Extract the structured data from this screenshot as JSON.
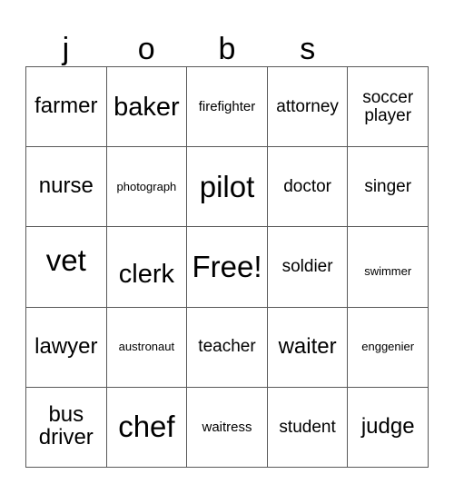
{
  "card": {
    "title_letters": [
      "j",
      "o",
      "b",
      "s",
      ""
    ],
    "grid": {
      "rows": 5,
      "columns": 5,
      "border_color": "#595959",
      "background_color": "#ffffff",
      "text_color": "#000000"
    },
    "cells": [
      [
        {
          "label": "farmer",
          "size": "l"
        },
        {
          "label": "baker",
          "size": "xl"
        },
        {
          "label": "firefighter",
          "size": "s"
        },
        {
          "label": "attorney",
          "size": "m"
        },
        {
          "label": "soccer\nplayer",
          "size": "m"
        }
      ],
      [
        {
          "label": "nurse",
          "size": "l",
          "valign": "center"
        },
        {
          "label": "photograph",
          "size": "xs"
        },
        {
          "label": "pilot",
          "size": "xxl"
        },
        {
          "label": "doctor",
          "size": "m"
        },
        {
          "label": "singer",
          "size": "m"
        }
      ],
      [
        {
          "label": "vet",
          "size": "xxl",
          "valign": "up"
        },
        {
          "label": "clerk",
          "size": "xl",
          "valign": "down"
        },
        {
          "label": "Free!",
          "size": "xxl"
        },
        {
          "label": "soldier",
          "size": "m"
        },
        {
          "label": "swimmer",
          "size": "xs",
          "valign": "down2"
        }
      ],
      [
        {
          "label": "lawyer",
          "size": "l"
        },
        {
          "label": "austronaut",
          "size": "xs"
        },
        {
          "label": "teacher",
          "size": "m"
        },
        {
          "label": "waiter",
          "size": "l"
        },
        {
          "label": "enggenier",
          "size": "xs"
        }
      ],
      [
        {
          "label": "bus\ndriver",
          "size": "l"
        },
        {
          "label": "chef",
          "size": "xxl"
        },
        {
          "label": "waitress",
          "size": "s"
        },
        {
          "label": "student",
          "size": "m"
        },
        {
          "label": "judge",
          "size": "l"
        }
      ]
    ]
  }
}
